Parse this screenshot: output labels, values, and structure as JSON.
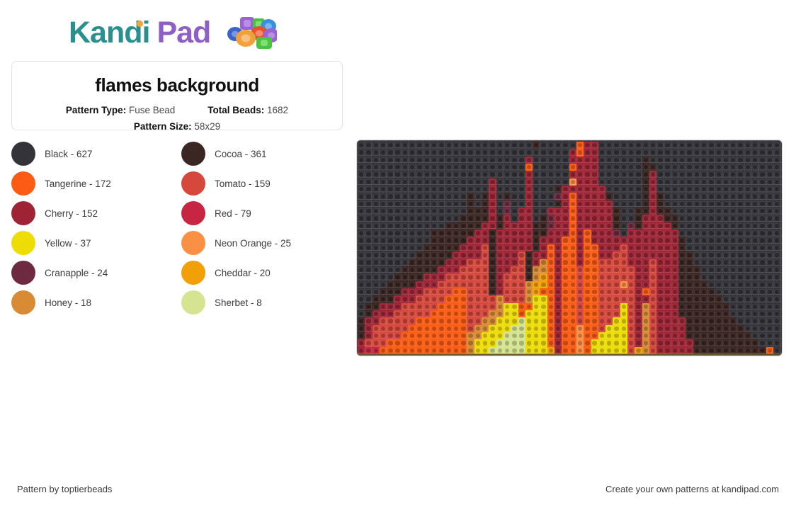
{
  "brand": {
    "name_part1": "Kandi",
    "name_part2": "Pad",
    "teal": "#2a8f8f",
    "purple": "#8e5fc4"
  },
  "card": {
    "title": "flames background",
    "pattern_type_label": "Pattern Type:",
    "pattern_type_value": "Fuse Bead",
    "total_beads_label": "Total Beads:",
    "total_beads_value": "1682",
    "pattern_size_label": "Pattern Size:",
    "pattern_size_value": "58x29"
  },
  "legend": {
    "items": [
      {
        "name": "Black",
        "count": "627",
        "label": "Black - 627",
        "hex": "#333339"
      },
      {
        "name": "Cocoa",
        "count": "361",
        "label": "Cocoa - 361",
        "hex": "#3a2622"
      },
      {
        "name": "Tangerine",
        "count": "172",
        "label": "Tangerine - 172",
        "hex": "#fb5b12"
      },
      {
        "name": "Tomato",
        "count": "159",
        "label": "Tomato - 159",
        "hex": "#d6473c"
      },
      {
        "name": "Cherry",
        "count": "152",
        "label": "Cherry - 152",
        "hex": "#9e2435"
      },
      {
        "name": "Red",
        "count": "79",
        "label": "Red - 79",
        "hex": "#c72642"
      },
      {
        "name": "Yellow",
        "count": "37",
        "label": "Yellow - 37",
        "hex": "#eddc06"
      },
      {
        "name": "Neon Orange",
        "count": "25",
        "label": "Neon Orange - 25",
        "hex": "#fa9045"
      },
      {
        "name": "Cranapple",
        "count": "24",
        "label": "Cranapple - 24",
        "hex": "#6e2a40"
      },
      {
        "name": "Cheddar",
        "count": "20",
        "label": "Cheddar - 20",
        "hex": "#f1a007"
      },
      {
        "name": "Honey",
        "count": "18",
        "label": "Honey - 18",
        "hex": "#d88b33"
      },
      {
        "name": "Sherbet",
        "count": "8",
        "label": "Sherbet - 8",
        "hex": "#d4e490"
      }
    ]
  },
  "pattern": {
    "columns": 58,
    "rows": 29,
    "palette": {
      "K": "#333339",
      "C": "#3a2622",
      "T": "#fb5b12",
      "M": "#d6473c",
      "H": "#9e2435",
      "R": "#c72642",
      "Y": "#eddc06",
      "N": "#fa9045",
      "P": "#6e2a40",
      "D": "#f1a007",
      "O": "#d88b33",
      "S": "#d4e490"
    },
    "grid": [
      "KKKKKKKKKKKKKKKKKKKKKKKKCKKKKKTHHKKKKKKKKKKKKKKKKKKKKKKKKK",
      "KKKKKKKKKKKKKKKKKKKKKKKKKKKKKHTHHKKKKKKKKKKKKKKKKKKKKKKKKK",
      "KKKKKKKKKKKKKKKKKKKKKKKHKKKKKHHHHKKKKKKCKKKKKKKKKKKKKKKKKK",
      "KKKKKKKKKKKKKKKKKKKKKKKTKKKKKTHHHKKKKKKCCKKKKKKKKKKKKKKKKK",
      "KKKKKKKKKKKKKKKKKKKKKKKHKKKKKHHHHKKKKKKCHKKKKKKKKKKKKKKKKK",
      "KKKKKKKKKKKKKKKKKKHKKKKHKKKKKNHHHKKKKKKCHKKKKKKKKKKKKKKKKK",
      "KKKKKKKKKKKKKKKKKKHKKKKHKKKCHHHHHHKKKKKCHKKKKKKKKKKKKKKKKK",
      "KKKKKKKKKKKKKKKCKCHKCKKHKKKPHTHHHHCKKKKCHCKKKKKKKKKKKKKKKK",
      "KKKKKKKKKKKKKKKCKCHKPKKHKKKCHTHHHHHKKKKCHCKKKKKKKKKKKKKKKK",
      "KKKKKKKKKKKKKKKCCCHKPKHHKKHHHTHHHHHCKKCCHCCKKKKKKKKKKKKKKK",
      "KKKKKKKKKKKKKKCCCCHCHKHHKCPHHTHHHHHCKKCHHHCCKKKKKKKKKKKKKK",
      "KKKKKKKKKKKKCCCCCHHCHHHHCCPHHTHHHHHCKPCHHHHCKKKKKKKKKKKKKK",
      "KKKKKKKKKKCCCCCCHHCHHHHHCCHHHTHTHHHPKHHHHHHHKKKKKKKKKKKKKK",
      "KKKKKKKKKKCCCCCHHHCHHHHHCHHHTTHTHHHHHHHHHHHHCKKKKKKKKKKKKK",
      "KKKKKKKKKCCCCCHHHMCHHHHHCHTHTTHTTHHHMHHHHHHHCKKKKKKKKKKKKK",
      "KKKKKKKKCCCCCHHHHMCHHHMCHHTHTTHTTHHMMHHHHHHHCCKKKKKKKKKKKK",
      "KKKKKKKCCCCCHHHMMMCHHHMCHOTHTTHTTMMMMHHHMHHHCCKKKKKKKKKKKK",
      "KKKKKKCCCCCHHHMMMMCHHMMCOOTHTTMTTMMMMMHHMHHHCCCKKKKKKKKKKK",
      "KKKKKCCCCHHHMMMMMMCHMMMCODTHTTMTTMMMMMHHMHHHCCCKKKKKKKKKKK",
      "KKKKCCCCHHHMMMMMMMCHMMMODDTHTTMTTMMMNMHHMHHHCCCCKKKKKKKKKK",
      "KKKCCCHHHMMMMTTMMMCHMMMODTTHTTMTTMMMMMHTMHHHCCCCCKKKKKKKKK",
      "KKCCCHHHMMMMTTTMMMMOMMMOYYTHTTMTTMMMMMHHMHHHCCCCCCKKKKKKKK",
      "KCCHHHMMMMMTTTTMMMMOYYTTYYTHTTMTTMMMYMHOMHHHCCCCCCCKKKKKKK",
      "KCHHHMMMMMTTTTTMMMOOYYTYYYTHTTMTTMMMYMHOMHHHCCCCCCCKKKKKKK",
      "CHHMMMMMTTTTTTTMMOOYYYSYYYTHTTMTTMMYYMHOMHHHHCCCCCCCKKKKKK",
      "CHMMMMMTTTTTTTTMOOYYYSSYYYTHTTNTTMYYYMHOMHHHHCCCCCCCCKKKKK",
      "CHMMMMTTTTTTTTTOOYYYSSSYYYTHTTNTTYYYYMHOMHHHHCCCCCCCCCKKKK",
      "HMMMTTTTTTTTTTTOYYYSSSSYYYTHTTNTYYYYYMHOMHHHHHCCCCCCCCCKKK",
      "HRRTTTTTTTTTTTTOYYSSSSSYYYDHTTNTYYYYYMDOMHHHHHCCCCCCCCCCTK"
    ]
  },
  "footer": {
    "left": "Pattern by toptierbeads",
    "right": "Create your own patterns at kandipad.com"
  }
}
